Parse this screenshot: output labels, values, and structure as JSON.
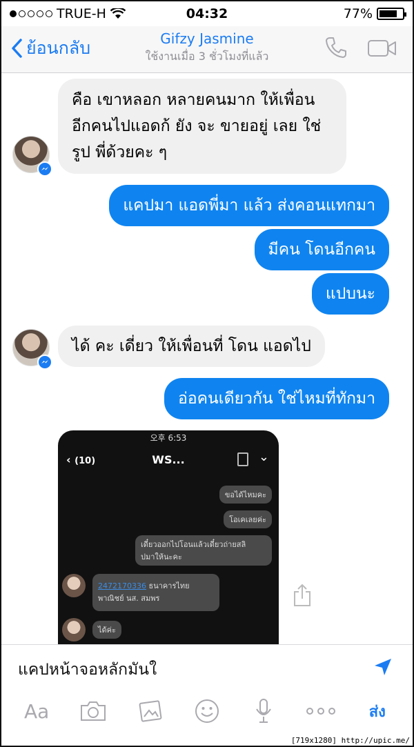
{
  "status": {
    "carrier": "TRUE-H",
    "time": "04:32",
    "battery": "77%",
    "battery_level": 0.77
  },
  "nav": {
    "back_label": "ย้อนกลับ",
    "contact_name": "Gifzy Jasmine",
    "last_active": "ใช้งานเมื่อ 3 ชั่วโมงที่แล้ว"
  },
  "messages": [
    {
      "dir": "in",
      "lines": [
        "คือ เขาหลอก  หลายคนมาก ให้เพื่อน",
        "อีกคนไปแอดก้ ยัง จะ ขายอยู่ เลย ใช่",
        "รูป พี่ด้วยคะ ๆ"
      ]
    },
    {
      "dir": "out",
      "text": "แคปมา แอดพี่มา แล้ว ส่งคอนแทกมา"
    },
    {
      "dir": "out",
      "text": "มีคน โดนอีกคน"
    },
    {
      "dir": "out",
      "text": "แปบนะ"
    },
    {
      "dir": "in",
      "text": "ได้  คะ เดี่ยว ให้เพื่อนที่ โดน แอดไป"
    },
    {
      "dir": "out",
      "text": "อ่อคนเดียวกัน ใช่ไหมที่ทักมา"
    }
  ],
  "shared_image": {
    "status_time": "오후 6:53",
    "back": "(10)",
    "title": "WS...",
    "msg1": "ขอได้ไหมคะ",
    "msg2": "โอเคเลยค่ะ",
    "msg3_line1": "เดี๋ยวออกไปโอนแล้วเดี๋ยวถ่ายสลิ",
    "msg3_line2": "ปมาให้นะคะ",
    "account_number": "2472170336",
    "bank_line1": "ธนาคารไทย",
    "bank_line2": "พาณิชย์ นส. สมพร",
    "last_msg": "ได้ค่ะ"
  },
  "composer": {
    "text": "แคปหน้าจอหลักมันใ",
    "send_label": "ส่ง",
    "text_tool": "Aa"
  },
  "watermark": "[719x1280] http://upic.me/"
}
